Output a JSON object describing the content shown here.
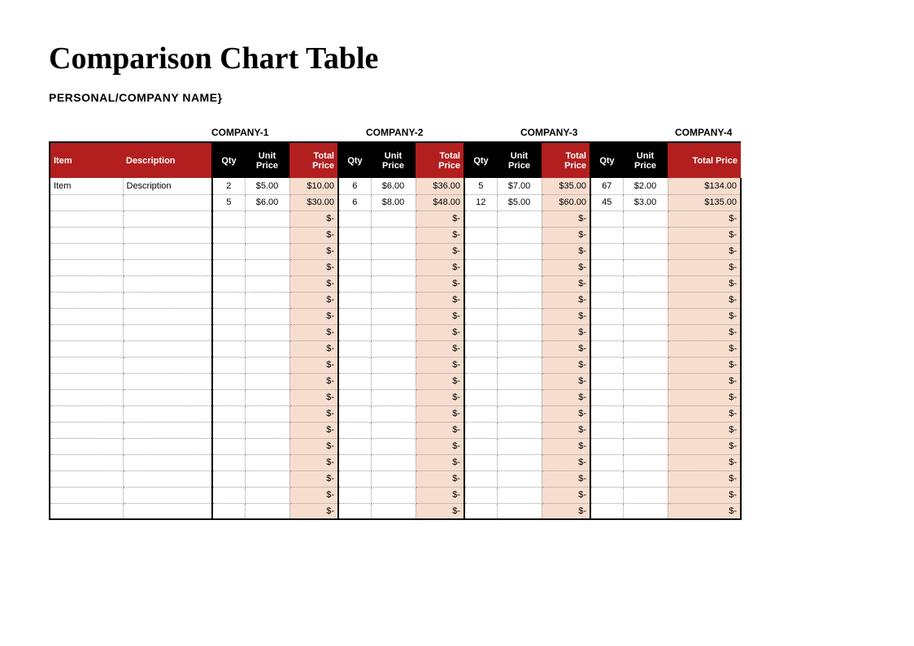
{
  "title": "Comparison Chart Table",
  "subtitle": "PERSONAL/COMPANY NAME}",
  "headers": {
    "item": "Item",
    "description": "Description",
    "qty": "Qty",
    "unit_price": "Unit Price",
    "total_price": "Total Price"
  },
  "companies": [
    "COMPANY-1",
    "COMPANY-2",
    "COMPANY-3",
    "COMPANY-4"
  ],
  "empty_total": "$-",
  "rows": [
    {
      "item": "Item",
      "description": "Description",
      "c1": {
        "qty": "2",
        "unit": "$5.00",
        "total": "$10.00"
      },
      "c2": {
        "qty": "6",
        "unit": "$6.00",
        "total": "$36.00"
      },
      "c3": {
        "qty": "5",
        "unit": "$7.00",
        "total": "$35.00"
      },
      "c4": {
        "qty": "67",
        "unit": "$2.00",
        "total": "$134.00"
      }
    },
    {
      "item": "",
      "description": "",
      "c1": {
        "qty": "5",
        "unit": "$6.00",
        "total": "$30.00"
      },
      "c2": {
        "qty": "6",
        "unit": "$8.00",
        "total": "$48.00"
      },
      "c3": {
        "qty": "12",
        "unit": "$5.00",
        "total": "$60.00"
      },
      "c4": {
        "qty": "45",
        "unit": "$3.00",
        "total": "$135.00"
      }
    }
  ],
  "empty_row_count": 19,
  "chart_data": {
    "type": "table",
    "title": "Comparison Chart Table",
    "columns": [
      "Item",
      "Description",
      "C1 Qty",
      "C1 Unit",
      "C1 Total",
      "C2 Qty",
      "C2 Unit",
      "C2 Total",
      "C3 Qty",
      "C3 Unit",
      "C3 Total",
      "C4 Qty",
      "C4 Unit",
      "C4 Total"
    ],
    "rows": [
      [
        "Item",
        "Description",
        2,
        5.0,
        10.0,
        6,
        6.0,
        36.0,
        5,
        7.0,
        35.0,
        67,
        2.0,
        134.0
      ],
      [
        "",
        "",
        5,
        6.0,
        30.0,
        6,
        8.0,
        48.0,
        12,
        5.0,
        60.0,
        45,
        3.0,
        135.0
      ]
    ]
  }
}
